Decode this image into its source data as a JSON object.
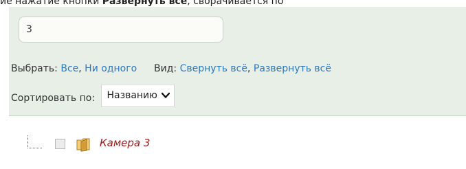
{
  "caption": {
    "prefix": "ие нажатие кнопки ",
    "bold": "Развернуть все",
    "suffix": ", сворачивается по"
  },
  "search": {
    "value": "3"
  },
  "select_row": {
    "select_label": "Выбрать:",
    "all": "Все",
    "comma1": ",",
    "none": "Ни одного",
    "view_label": "Вид:",
    "collapse_all": "Свернуть всё",
    "comma2": ",",
    "expand_all": "Развернуть всё"
  },
  "sort_row": {
    "label": "Сортировать по:",
    "selected": "Названию"
  },
  "tree": {
    "items": [
      {
        "label": "Камера 3",
        "checked": false,
        "icon": "folder-icon"
      }
    ]
  },
  "colors": {
    "panel_bg": "#e7efe7",
    "link": "#2a78c4",
    "item_label": "#a01c1c",
    "folder": "#e8b64a"
  }
}
